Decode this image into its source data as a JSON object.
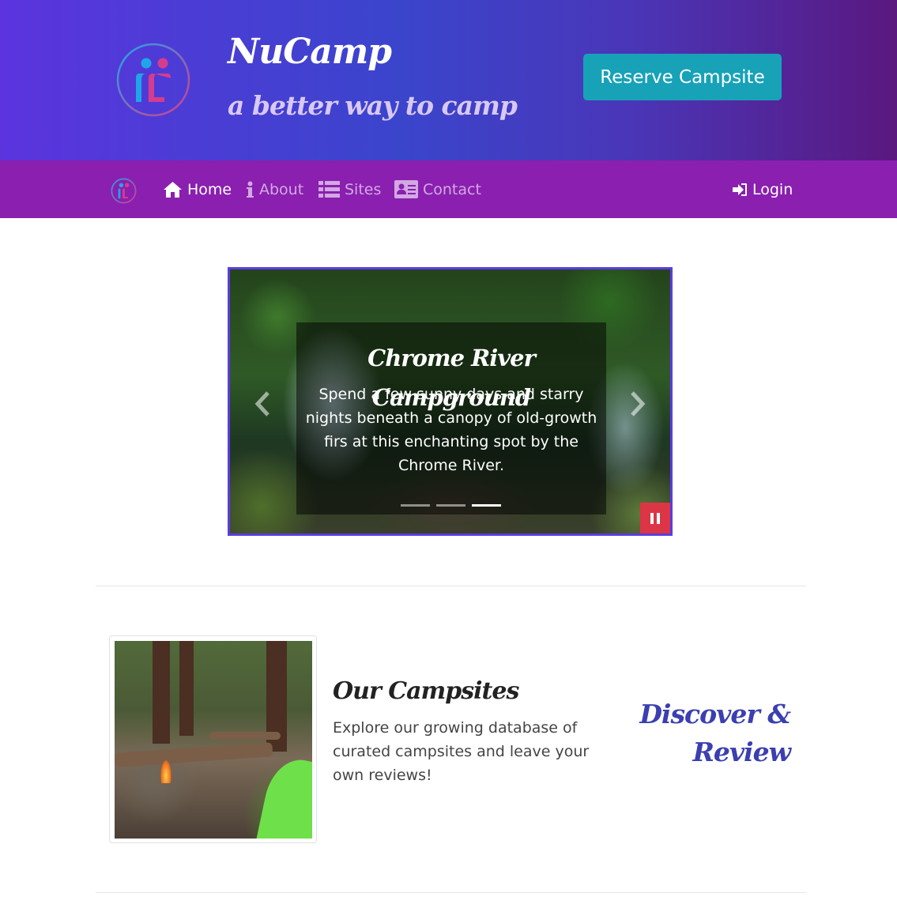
{
  "header": {
    "brand_title": "NuCamp",
    "brand_subtitle": "a better way to camp",
    "reserve_button": "Reserve Campsite",
    "logo_icon": "nucamp-logo-icon"
  },
  "nav": {
    "items": [
      {
        "label": "Home",
        "icon": "home-icon",
        "active": true
      },
      {
        "label": "About",
        "icon": "info-icon",
        "active": false
      },
      {
        "label": "Sites",
        "icon": "list-icon",
        "active": false
      },
      {
        "label": "Contact",
        "icon": "address-card-icon",
        "active": false
      }
    ],
    "login_label": "Login",
    "login_icon": "sign-in-icon"
  },
  "carousel": {
    "caption_title": "Chrome River Campground",
    "caption_text": "Spend a few sunny days and starry nights beneath a canopy of old-growth firs at this enchanting spot by the Chrome River.",
    "slide_count": 3,
    "active_slide": 3,
    "prev_icon": "chevron-left-icon",
    "next_icon": "chevron-right-icon",
    "pause_icon": "pause-icon"
  },
  "feature": {
    "title": "Our Campsites",
    "text": "Explore our growing database of curated campsites and leave your own reviews!",
    "tagline": "Discover & Review"
  },
  "colors": {
    "header_gradient_start": "#5b34de",
    "header_gradient_end": "#5a1880",
    "navbar": "#8a1fb0",
    "reserve_button": "#17a2b8",
    "pause_button": "#dc3545",
    "carousel_border": "#5a3de0",
    "tagline": "#3b3fb0"
  }
}
